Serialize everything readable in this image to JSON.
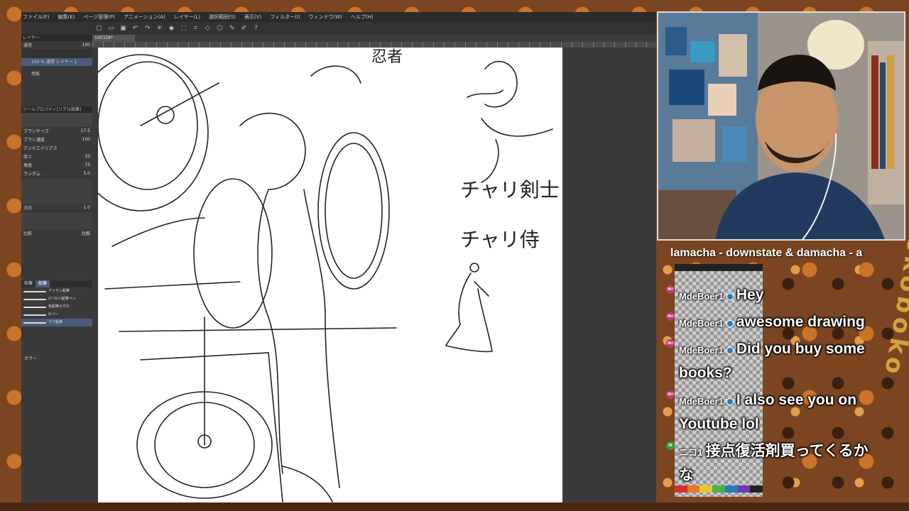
{
  "menu": [
    "ファイル(F)",
    "編集(E)",
    "ページ管理(P)",
    "アニメーション(A)",
    "レイヤー(L)",
    "選択範囲(S)",
    "表示(V)",
    "フィルター(I)",
    "ウィンドウ(W)",
    "ヘルプ(H)"
  ],
  "document_tab": "160328*",
  "layer_panel": {
    "header": "レイヤー",
    "blend": "通常",
    "opacity": "100",
    "layers": [
      {
        "label": "100 % 通常 レイヤー 1"
      },
      {
        "label": "用紙"
      }
    ]
  },
  "tool_property": {
    "header": "ツールプロパティ[リアル鉛筆]",
    "rows": [
      {
        "label": "ブラシサイズ",
        "value": "17.5"
      },
      {
        "label": "ブラシ濃度",
        "value": "100"
      },
      {
        "label": "アンチエイリアス",
        "value": ""
      },
      {
        "label": "厚さ",
        "value": "10"
      },
      {
        "label": "角度",
        "value": "73"
      },
      {
        "label": "ランダム",
        "value": "5.0"
      },
      {
        "label": "方向",
        "value": "1.0"
      },
      {
        "label": "比較",
        "value": "1"
      }
    ],
    "compare_label": "比較"
  },
  "subtool_panel": {
    "tabs": [
      "鉛筆",
      "鉛筆"
    ],
    "brushes": [
      "デッサン鉛筆",
      "(ﾊﾟｲﾛｯﾄ)鉛筆ペン",
      "色鉛筆かすれ",
      "Gペン",
      "ラフ鉛筆"
    ]
  },
  "color_panel_label": "カラー",
  "sketch_texts": [
    "忍者",
    "チャリ剣士",
    "チャリ侍"
  ],
  "now_playing": "lamacha - downstate & damacha - a",
  "chat": [
    {
      "badge": "MU",
      "user": "MdeBoer1",
      "text": "Hey",
      "icon": true
    },
    {
      "badge": "MU",
      "user": "MdeBoer1",
      "text": "awesome drawing",
      "icon": true
    },
    {
      "badge": "MU",
      "user": "MdeBoer1",
      "text": "Did you buy some books?",
      "icon": true
    },
    {
      "badge": "MU",
      "user": "MdeBoer1",
      "text": "I also see you on Youtube lol",
      "icon": true
    },
    {
      "badge": "NI",
      "user": "ニコ1",
      "text": "接点復活剤買ってくるかな",
      "icon": false
    }
  ],
  "watermark": "nekoboko",
  "colors": {
    "chat_badge": "#c0396b",
    "chat_badge_green": "#3a9d3a",
    "palette": [
      "#d63030",
      "#e07a20",
      "#e8c830",
      "#4caf50",
      "#2a7ab8",
      "#6a3ab8",
      "#222222"
    ]
  }
}
